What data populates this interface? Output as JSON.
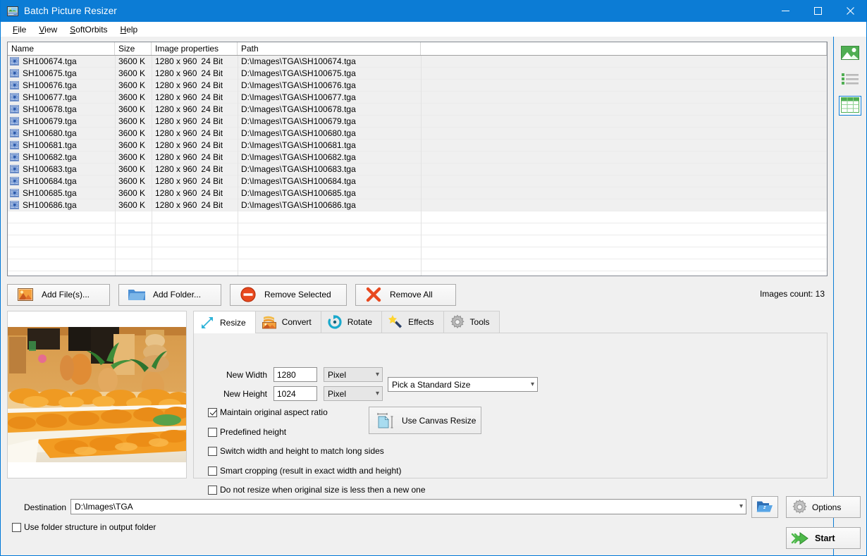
{
  "window": {
    "title": "Batch Picture Resizer",
    "icon": "app-picture-icon",
    "minimize": "─",
    "maximize": "□",
    "close": "✕",
    "accent_color": "#0c7cd5"
  },
  "menubar": {
    "items": [
      {
        "label": "File",
        "mnemonic": "F"
      },
      {
        "label": "View",
        "mnemonic": "V"
      },
      {
        "label": "SoftOrbits",
        "mnemonic": "S"
      },
      {
        "label": "Help",
        "mnemonic": "H"
      }
    ]
  },
  "file_list": {
    "columns": [
      "Name",
      "Size",
      "Image properties",
      "Path"
    ],
    "rows": [
      {
        "name": "SH100674.tga",
        "size": "3600 K",
        "dimensions": "1280 x 960",
        "depth": "24 Bit",
        "path": "D:\\Images\\TGA\\SH100674.tga"
      },
      {
        "name": "SH100675.tga",
        "size": "3600 K",
        "dimensions": "1280 x 960",
        "depth": "24 Bit",
        "path": "D:\\Images\\TGA\\SH100675.tga"
      },
      {
        "name": "SH100676.tga",
        "size": "3600 K",
        "dimensions": "1280 x 960",
        "depth": "24 Bit",
        "path": "D:\\Images\\TGA\\SH100676.tga"
      },
      {
        "name": "SH100677.tga",
        "size": "3600 K",
        "dimensions": "1280 x 960",
        "depth": "24 Bit",
        "path": "D:\\Images\\TGA\\SH100677.tga"
      },
      {
        "name": "SH100678.tga",
        "size": "3600 K",
        "dimensions": "1280 x 960",
        "depth": "24 Bit",
        "path": "D:\\Images\\TGA\\SH100678.tga"
      },
      {
        "name": "SH100679.tga",
        "size": "3600 K",
        "dimensions": "1280 x 960",
        "depth": "24 Bit",
        "path": "D:\\Images\\TGA\\SH100679.tga"
      },
      {
        "name": "SH100680.tga",
        "size": "3600 K",
        "dimensions": "1280 x 960",
        "depth": "24 Bit",
        "path": "D:\\Images\\TGA\\SH100680.tga"
      },
      {
        "name": "SH100681.tga",
        "size": "3600 K",
        "dimensions": "1280 x 960",
        "depth": "24 Bit",
        "path": "D:\\Images\\TGA\\SH100681.tga"
      },
      {
        "name": "SH100682.tga",
        "size": "3600 K",
        "dimensions": "1280 x 960",
        "depth": "24 Bit",
        "path": "D:\\Images\\TGA\\SH100682.tga"
      },
      {
        "name": "SH100683.tga",
        "size": "3600 K",
        "dimensions": "1280 x 960",
        "depth": "24 Bit",
        "path": "D:\\Images\\TGA\\SH100683.tga"
      },
      {
        "name": "SH100684.tga",
        "size": "3600 K",
        "dimensions": "1280 x 960",
        "depth": "24 Bit",
        "path": "D:\\Images\\TGA\\SH100684.tga"
      },
      {
        "name": "SH100685.tga",
        "size": "3600 K",
        "dimensions": "1280 x 960",
        "depth": "24 Bit",
        "path": "D:\\Images\\TGA\\SH100685.tga"
      },
      {
        "name": "SH100686.tga",
        "size": "3600 K",
        "dimensions": "1280 x 960",
        "depth": "24 Bit",
        "path": "D:\\Images\\TGA\\SH100686.tga"
      }
    ]
  },
  "filebar": {
    "add_files": "Add File(s)...",
    "add_folder": "Add Folder...",
    "remove_selected": "Remove Selected",
    "remove_all": "Remove All",
    "images_count": "Images count: 13"
  },
  "tabs": [
    {
      "label": "Resize",
      "icon": "resize-arrows-icon",
      "active": true
    },
    {
      "label": "Convert",
      "icon": "convert-image-icon",
      "active": false
    },
    {
      "label": "Rotate",
      "icon": "rotate-circle-icon",
      "active": false
    },
    {
      "label": "Effects",
      "icon": "magic-wand-icon",
      "active": false
    },
    {
      "label": "Tools",
      "icon": "gear-icon",
      "active": false
    }
  ],
  "resize_panel": {
    "new_width_label": "New Width",
    "new_width_value": "1280",
    "new_width_unit": "Pixel",
    "new_height_label": "New Height",
    "new_height_value": "1024",
    "new_height_unit": "Pixel",
    "standard_size": "Pick a Standard Size",
    "canvas_resize": "Use Canvas Resize",
    "checkboxes": [
      {
        "label": "Maintain original aspect ratio",
        "checked": true
      },
      {
        "label": "Predefined height",
        "checked": false
      },
      {
        "label": "Switch width and height to match long sides",
        "checked": false
      },
      {
        "label": "Smart cropping (result in exact width and height)",
        "checked": false
      },
      {
        "label": "Do not resize when original size is less then a new one",
        "checked": false
      }
    ]
  },
  "destination": {
    "label": "Destination",
    "value": "D:\\Images\\TGA",
    "browse_icon": "open-folder-icon",
    "options_label": "Options",
    "options_icon": "gear-icon",
    "start_label": "Start",
    "start_icon": "green-arrow-icon",
    "use_folder_structure": "Use folder structure in output folder",
    "use_folder_structure_checked": false
  },
  "sidebar": {
    "views": [
      {
        "name": "thumbnail-view",
        "icon": "picture-icon",
        "selected": false
      },
      {
        "name": "list-view",
        "icon": "list-icon",
        "selected": false
      },
      {
        "name": "grid-view",
        "icon": "grid-icon",
        "selected": true
      }
    ]
  }
}
